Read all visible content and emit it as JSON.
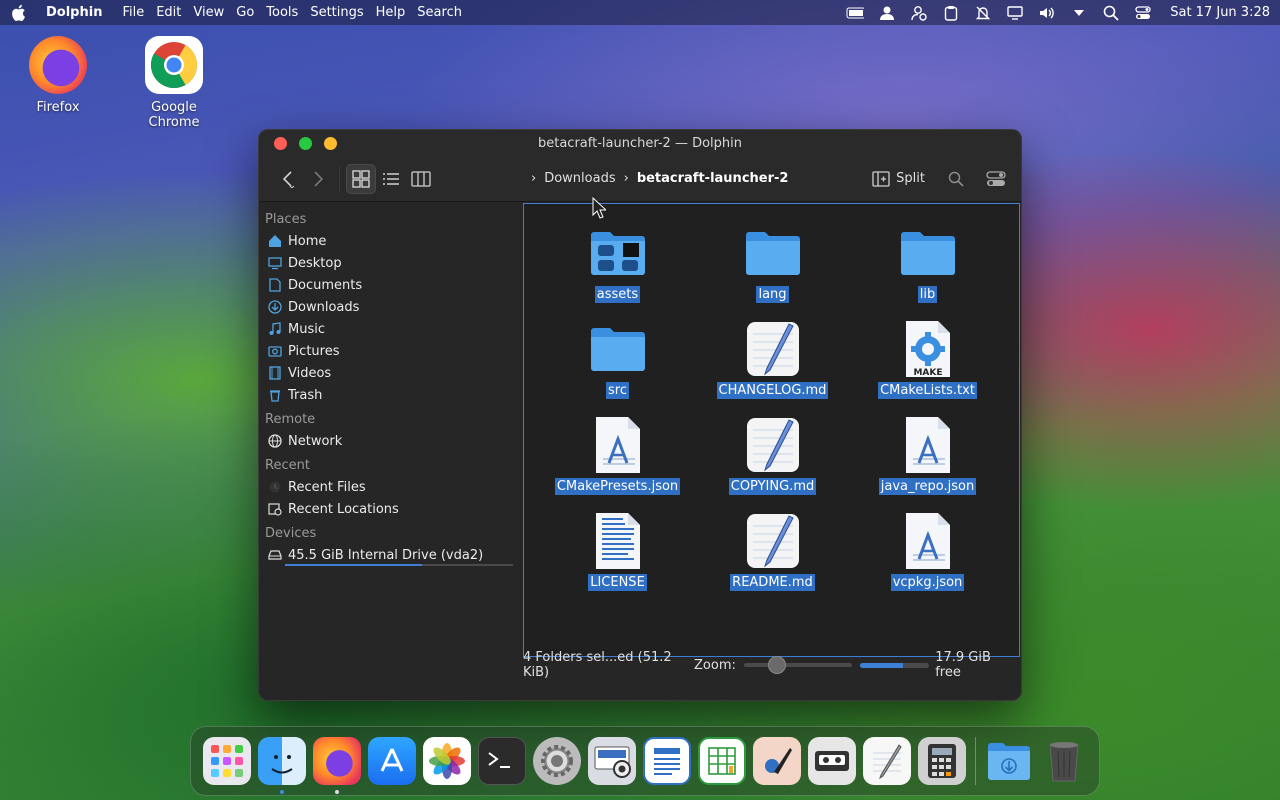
{
  "menubar": {
    "app_name": "Dolphin",
    "menus": [
      "File",
      "Edit",
      "View",
      "Go",
      "Tools",
      "Settings",
      "Help",
      "Search"
    ],
    "clock": "Sat 17 Jun 3:28"
  },
  "desktop": {
    "icons": [
      {
        "label": "Firefox",
        "icon": "firefox-icon"
      },
      {
        "label": "Google Chrome",
        "icon": "chrome-icon"
      }
    ]
  },
  "window": {
    "title": "betacraft-launcher-2 — Dolphin",
    "breadcrumb": [
      "Downloads",
      "betacraft-launcher-2"
    ],
    "split_label": "Split"
  },
  "sidebar": {
    "sections": [
      {
        "title": "Places",
        "items": [
          {
            "label": "Home",
            "icon": "home-icon"
          },
          {
            "label": "Desktop",
            "icon": "desktop-icon"
          },
          {
            "label": "Documents",
            "icon": "documents-icon"
          },
          {
            "label": "Downloads",
            "icon": "downloads-icon"
          },
          {
            "label": "Music",
            "icon": "music-icon"
          },
          {
            "label": "Pictures",
            "icon": "pictures-icon"
          },
          {
            "label": "Videos",
            "icon": "videos-icon"
          },
          {
            "label": "Trash",
            "icon": "trash-icon"
          }
        ]
      },
      {
        "title": "Remote",
        "items": [
          {
            "label": "Network",
            "icon": "network-icon"
          }
        ]
      },
      {
        "title": "Recent",
        "items": [
          {
            "label": "Recent Files",
            "icon": "recent-files-icon"
          },
          {
            "label": "Recent Locations",
            "icon": "recent-locations-icon"
          }
        ]
      },
      {
        "title": "Devices",
        "items": [
          {
            "label": "45.5 GiB Internal Drive (vda2)",
            "icon": "drive-icon"
          }
        ]
      }
    ]
  },
  "files": [
    {
      "name": "assets",
      "type": "folder-assets"
    },
    {
      "name": "lang",
      "type": "folder"
    },
    {
      "name": "lib",
      "type": "folder"
    },
    {
      "name": "src",
      "type": "folder"
    },
    {
      "name": "CHANGELOG.md",
      "type": "markdown"
    },
    {
      "name": "CMakeLists.txt",
      "type": "cmake"
    },
    {
      "name": "CMakePresets.json",
      "type": "json"
    },
    {
      "name": "COPYING.md",
      "type": "markdown"
    },
    {
      "name": "java_repo.json",
      "type": "json"
    },
    {
      "name": "LICENSE",
      "type": "text"
    },
    {
      "name": "README.md",
      "type": "markdown"
    },
    {
      "name": "vcpkg.json",
      "type": "json"
    }
  ],
  "statusbar": {
    "selection": "4 Folders sel...ed (51.2 KiB)",
    "zoom_label": "Zoom:",
    "free": "17.9 GiB free"
  },
  "dock": [
    "launchpad-icon",
    "finder-icon",
    "firefox-icon",
    "app-store-icon",
    "photos-icon",
    "terminal-icon",
    "system-settings-icon",
    "screenshot-icon",
    "writer-icon",
    "calc-icon",
    "draw-icon",
    "tape-icon",
    "textedit-icon",
    "calculator-icon",
    "downloads-folder-icon",
    "trash-icon"
  ]
}
